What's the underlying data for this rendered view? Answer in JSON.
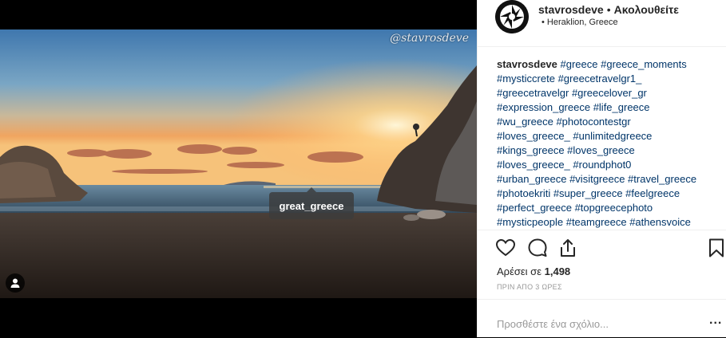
{
  "post": {
    "watermark": "@stavrosdeve",
    "photo_tag": "great_greece",
    "user_tag_icon": "person-icon"
  },
  "header": {
    "username": "stavrosdeve",
    "separator": "•",
    "follow_label": "Ακολουθείτε",
    "location": "• Heraklion, Greece"
  },
  "caption": {
    "username": "stavrosdeve",
    "lines": [
      "#greece #greece_moments",
      "#mysticcrete #greecetravelgr1_",
      "#greecetravelgr #greecelover_gr",
      "#expression_greece #life_greece",
      "#wu_greece #photocontestgr",
      "#loves_greece_ #unlimitedgreece",
      "#kings_greece #loves_greece",
      "#loves_greece_ #roundphot0",
      "#urban_greece #visitgreece #travel_greece",
      "#photoekriti #super_greece #feelgreece",
      "#perfect_greece #topgreecephoto",
      "#mysticpeople #teamgreece #athensvoice"
    ]
  },
  "actions": {
    "likes_prefix": "Αρέσει σε",
    "likes_count": "1,498",
    "timestamp": "ΠΡΙΝ ΑΠΟ 3 ΩΡΕΣ",
    "icons": [
      "heart-icon",
      "comment-icon",
      "share-icon",
      "bookmark-icon"
    ]
  },
  "comment": {
    "placeholder": "Προσθέστε ένα σχόλιο...",
    "more_label": "..."
  }
}
